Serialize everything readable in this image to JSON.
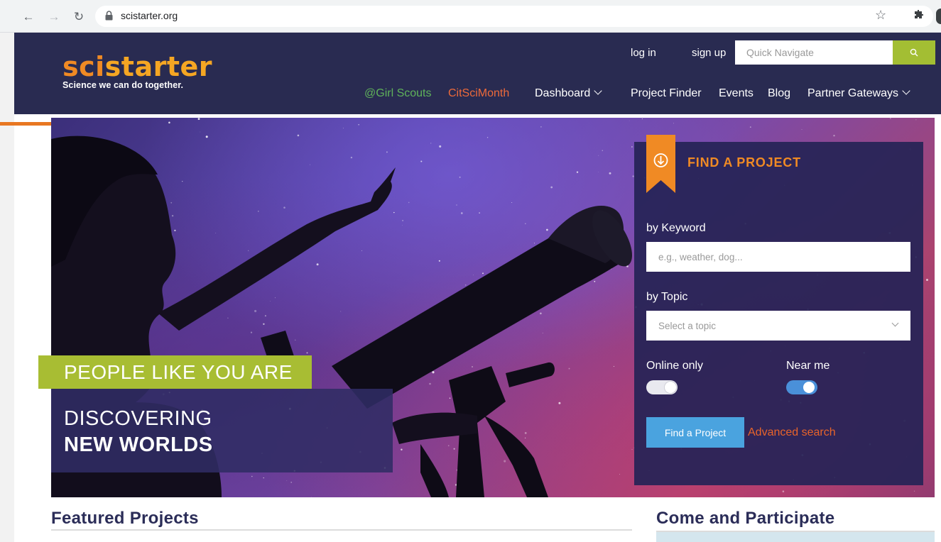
{
  "browser": {
    "url": "scistarter.org"
  },
  "header": {
    "logo_sci": "sci",
    "logo_starter": "starter",
    "tagline": "Science we can do together.",
    "login": "log in",
    "signup": "sign up",
    "quick_nav_placeholder": "Quick Navigate",
    "nav": {
      "girl_scouts": "@Girl Scouts",
      "citsci_month": "CitSciMonth",
      "dashboard": "Dashboard",
      "project_finder": "Project Finder",
      "events": "Events",
      "blog": "Blog",
      "partner_gateways": "Partner Gateways"
    }
  },
  "hero": {
    "tagline_green": "PEOPLE LIKE YOU ARE",
    "line1": "DISCOVERING",
    "line2": "NEW WORLDS"
  },
  "finder": {
    "title": "FIND A PROJECT",
    "keyword_label": "by Keyword",
    "keyword_placeholder": "e.g., weather, dog...",
    "topic_label": "by Topic",
    "topic_selected": "Select a topic",
    "online_only_label": "Online only",
    "online_only_on": false,
    "near_me_label": "Near me",
    "near_me_on": true,
    "find_button": "Find a Project",
    "advanced_search": "Advanced search"
  },
  "sections": {
    "featured": "Featured Projects",
    "participate": "Come and Participate"
  },
  "colors": {
    "header_bg": "#292b51",
    "accent_orange": "#f08a24",
    "accent_green": "#a8bd33",
    "button_blue": "#4aa3df"
  }
}
